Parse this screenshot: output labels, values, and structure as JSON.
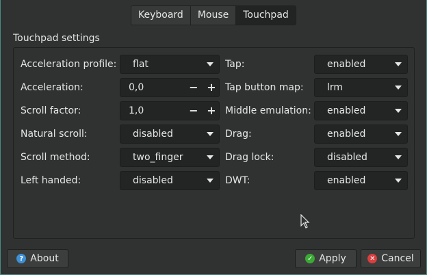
{
  "tabs": [
    {
      "label": "Keyboard"
    },
    {
      "label": "Mouse"
    },
    {
      "label": "Touchpad"
    }
  ],
  "group_title": "Touchpad settings",
  "left": {
    "accel_profile": {
      "label": "Acceleration profile:",
      "value": "flat"
    },
    "acceleration": {
      "label": "Acceleration:",
      "value": "0,0"
    },
    "scroll_factor": {
      "label": "Scroll factor:",
      "value": "1,0"
    },
    "natural_scroll": {
      "label": "Natural scroll:",
      "value": "disabled"
    },
    "scroll_method": {
      "label": "Scroll method:",
      "value": "two_finger"
    },
    "left_handed": {
      "label": "Left handed:",
      "value": "disabled"
    }
  },
  "right": {
    "tap": {
      "label": "Tap:",
      "value": "enabled"
    },
    "tap_button_map": {
      "label": "Tap button map:",
      "value": "lrm"
    },
    "middle_emulation": {
      "label": "Middle emulation:",
      "value": "enabled"
    },
    "drag": {
      "label": "Drag:",
      "value": "enabled"
    },
    "drag_lock": {
      "label": "Drag lock:",
      "value": "disabled"
    },
    "dwt": {
      "label": "DWT:",
      "value": "enabled"
    }
  },
  "buttons": {
    "about": "About",
    "apply": "Apply",
    "cancel": "Cancel"
  },
  "spin_symbols": {
    "minus": "−",
    "plus": "+"
  },
  "icons": {
    "about": "?",
    "apply": "✓",
    "cancel": "✕"
  },
  "colors": {
    "about_icon": "#3d8fd6",
    "apply_icon": "#3aaa35",
    "cancel_icon": "#da3e3e"
  }
}
